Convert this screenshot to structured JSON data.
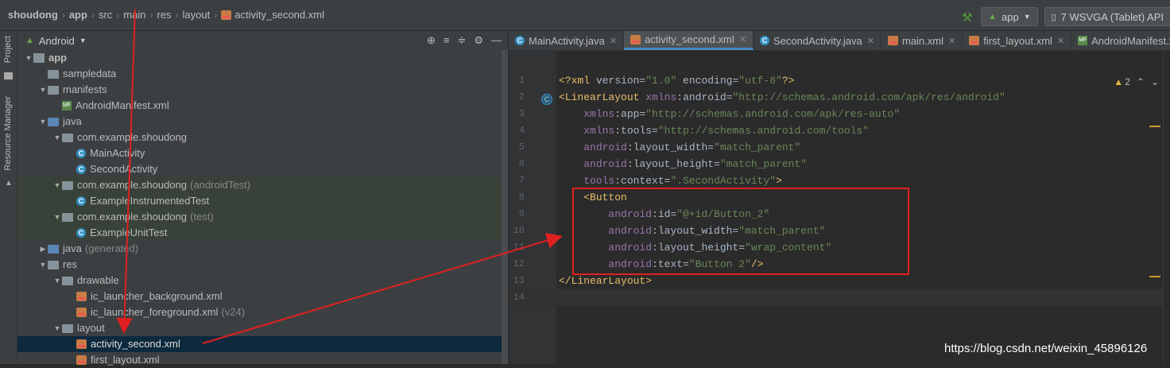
{
  "breadcrumb": {
    "items": [
      "shoudong",
      "app",
      "src",
      "main",
      "res",
      "layout",
      "activity_second.xml"
    ]
  },
  "toolbar": {
    "run_config": "app",
    "device": "7  WSVGA (Tablet) API"
  },
  "left_strip": {
    "project_label": "Project",
    "resource_manager_label": "Resource Manager"
  },
  "project_panel": {
    "view_label": "Android",
    "tree": [
      {
        "label": "app",
        "kind": "app",
        "indent": 0,
        "expanded": true
      },
      {
        "label": "sampledata",
        "kind": "folder",
        "indent": 1
      },
      {
        "label": "manifests",
        "kind": "folder",
        "indent": 1,
        "expanded": true
      },
      {
        "label": "AndroidManifest.xml",
        "kind": "manifest",
        "indent": 2
      },
      {
        "label": "java",
        "kind": "folder-src",
        "indent": 1,
        "expanded": true
      },
      {
        "label": "com.example.shoudong",
        "kind": "folder",
        "indent": 2,
        "expanded": true
      },
      {
        "label": "MainActivity",
        "kind": "class",
        "indent": 3
      },
      {
        "label": "SecondActivity",
        "kind": "class",
        "indent": 3
      },
      {
        "label": "com.example.shoudong",
        "suffix": "(androidTest)",
        "kind": "folder",
        "indent": 2,
        "expanded": true,
        "highlight": true
      },
      {
        "label": "ExampleInstrumentedTest",
        "kind": "class",
        "indent": 3,
        "highlight": true
      },
      {
        "label": "com.example.shoudong",
        "suffix": "(test)",
        "kind": "folder",
        "indent": 2,
        "expanded": true,
        "highlight": true
      },
      {
        "label": "ExampleUnitTest",
        "kind": "class",
        "indent": 3,
        "highlight": true
      },
      {
        "label": "java",
        "suffix": "(generated)",
        "kind": "folder-src",
        "indent": 1,
        "expanded": false
      },
      {
        "label": "res",
        "kind": "folder",
        "indent": 1,
        "expanded": true
      },
      {
        "label": "drawable",
        "kind": "folder",
        "indent": 2,
        "expanded": true
      },
      {
        "label": "ic_launcher_background.xml",
        "kind": "xml",
        "indent": 3
      },
      {
        "label": "ic_launcher_foreground.xml",
        "suffix": "(v24)",
        "kind": "xml",
        "indent": 3
      },
      {
        "label": "layout",
        "kind": "folder",
        "indent": 2,
        "expanded": true
      },
      {
        "label": "activity_second.xml",
        "kind": "xml",
        "indent": 3,
        "selected": true
      },
      {
        "label": "first_layout.xml",
        "kind": "xml",
        "indent": 3
      }
    ]
  },
  "editor": {
    "tabs": [
      {
        "label": "MainActivity.java",
        "icon": "class-icon"
      },
      {
        "label": "activity_second.xml",
        "icon": "xml-icon",
        "active": true
      },
      {
        "label": "SecondActivity.java",
        "icon": "class-icon"
      },
      {
        "label": "main.xml",
        "icon": "xml-icon"
      },
      {
        "label": "first_layout.xml",
        "icon": "xml-icon"
      },
      {
        "label": "AndroidManifest.xml",
        "icon": "manifest-icon"
      }
    ],
    "warnings": "2",
    "lines": [
      {
        "n": "1",
        "code": "<?xml version=\"1.0\" encoding=\"utf-8\"?>"
      },
      {
        "n": "2",
        "code": "<LinearLayout xmlns:android=\"http://schemas.android.com/apk/res/android\""
      },
      {
        "n": "3",
        "code": "    xmlns:app=\"http://schemas.android.com/apk/res-auto\""
      },
      {
        "n": "4",
        "code": "    xmlns:tools=\"http://schemas.android.com/tools\""
      },
      {
        "n": "5",
        "code": "    android:layout_width=\"match_parent\""
      },
      {
        "n": "6",
        "code": "    android:layout_height=\"match_parent\""
      },
      {
        "n": "7",
        "code": "    tools:context=\".SecondActivity\">"
      },
      {
        "n": "8",
        "code": "    <Button"
      },
      {
        "n": "9",
        "code": "        android:id=\"@+id/Button_2\""
      },
      {
        "n": "10",
        "code": "        android:layout_width=\"match_parent\""
      },
      {
        "n": "11",
        "code": "        android:layout_height=\"wrap_content\""
      },
      {
        "n": "12",
        "code": "        android:text=\"Button 2\"/>"
      },
      {
        "n": "13",
        "code": "</LinearLayout>"
      },
      {
        "n": "14",
        "code": ""
      }
    ]
  },
  "watermark": "https://blog.csdn.net/weixin_45896126"
}
